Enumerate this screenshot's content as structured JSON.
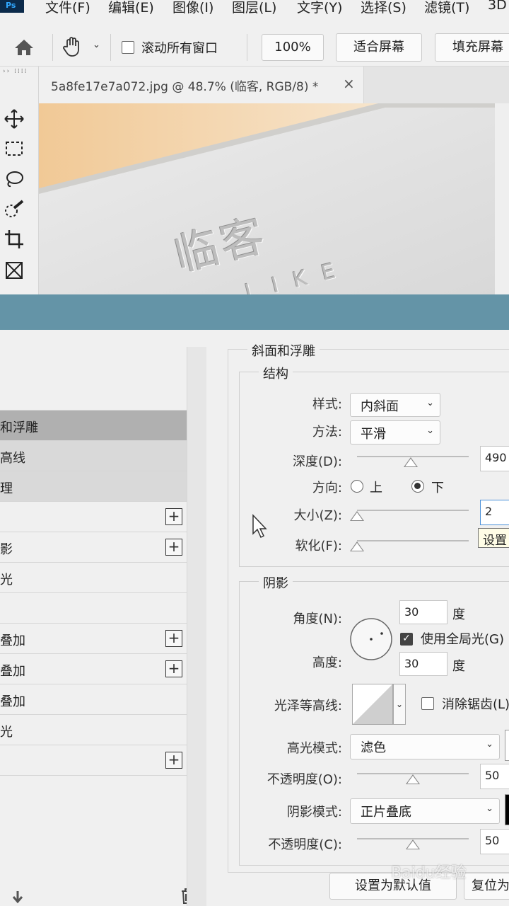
{
  "menu": {
    "items": [
      "文件(F)",
      "编辑(E)",
      "图像(I)",
      "图层(L)",
      "文字(Y)",
      "选择(S)",
      "滤镜(T)",
      "3D"
    ]
  },
  "options_bar": {
    "scroll_all_label": "滚动所有窗口",
    "zoom_value": "100%",
    "fit_screen": "适合屏幕",
    "fill_screen": "填充屏幕"
  },
  "document": {
    "tab_title": "5a8fe17e7a072.jpg @ 48.7% (临客, RGB/8) *",
    "close": "×",
    "canvas_text": "临客",
    "canvas_sub": "LIKE"
  },
  "layer_styles": {
    "rows": [
      {
        "label": "",
        "plus": false,
        "state": "none"
      },
      {
        "label": "和浮雕",
        "plus": false,
        "state": "selected"
      },
      {
        "label": "高线",
        "plus": false,
        "state": "highlight"
      },
      {
        "label": "理",
        "plus": false,
        "state": "highlight"
      },
      {
        "label": "",
        "plus": true,
        "state": "none"
      },
      {
        "label": "影",
        "plus": true,
        "state": "none"
      },
      {
        "label": "光",
        "plus": false,
        "state": "none"
      },
      {
        "label": "",
        "plus": false,
        "state": "none"
      },
      {
        "label": "叠加",
        "plus": true,
        "state": "none"
      },
      {
        "label": "叠加",
        "plus": true,
        "state": "none"
      },
      {
        "label": "叠加",
        "plus": false,
        "state": "none"
      },
      {
        "label": "光",
        "plus": false,
        "state": "none"
      },
      {
        "label": "",
        "plus": true,
        "state": "none"
      }
    ]
  },
  "bevel": {
    "title": "斜面和浮雕",
    "structure": {
      "title": "结构",
      "style_label": "样式:",
      "style_value": "内斜面",
      "technique_label": "方法:",
      "technique_value": "平滑",
      "depth_label": "深度(D):",
      "depth_value": "490",
      "depth_fraction": 0.48,
      "direction_label": "方向:",
      "dir_up": "上",
      "dir_down": "下",
      "size_label": "大小(Z):",
      "size_value": "2",
      "size_fraction": 0.0,
      "soften_label": "软化(F):",
      "soften_fraction": 0.0,
      "tooltip": "设置"
    },
    "shading": {
      "title": "阴影",
      "angle_label": "角度(N):",
      "angle_value": "30",
      "degree": "度",
      "global_light_label": "使用全局光(G)",
      "altitude_label": "高度:",
      "altitude_value": "30",
      "gloss_label": "光泽等高线:",
      "antialias_label": "消除锯齿(L)",
      "highlight_mode_label": "高光模式:",
      "highlight_mode_value": "滤色",
      "highlight_opacity_label": "不透明度(O):",
      "highlight_opacity_value": "50",
      "highlight_opacity_fraction": 0.5,
      "shadow_mode_label": "阴影模式:",
      "shadow_mode_value": "正片叠底",
      "shadow_opacity_label": "不透明度(C):",
      "shadow_opacity_value": "50",
      "shadow_opacity_fraction": 0.5
    },
    "buttons": {
      "make_default": "设置为默认值",
      "reset": "复位为"
    }
  },
  "colors": {
    "title_bar": "#6494a7",
    "selected_row": "#b0b0b0"
  },
  "watermark": "Baidu经验"
}
